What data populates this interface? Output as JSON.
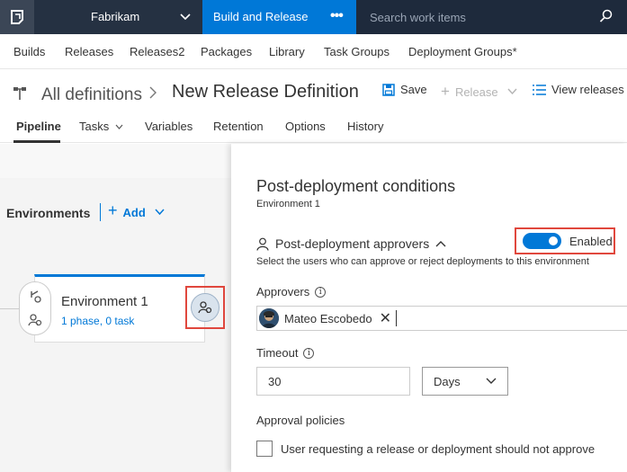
{
  "topnav": {
    "org": "Fabrikam",
    "active_hub": "Build and Release",
    "more": "•••",
    "search_placeholder": "Search work items"
  },
  "hubs": [
    "Builds",
    "Releases",
    "Releases2",
    "Packages",
    "Library",
    "Task Groups",
    "Deployment Groups*"
  ],
  "breadcrumb": {
    "all": "All definitions",
    "title": "New Release Definition"
  },
  "toolbar": {
    "save": "Save",
    "release": "Release",
    "view_releases": "View releases"
  },
  "tabs": [
    "Pipeline",
    "Tasks",
    "Variables",
    "Retention",
    "Options",
    "History"
  ],
  "pipeline": {
    "environments_label": "Environments",
    "add_label": "Add",
    "environment": {
      "name": "Environment 1",
      "summary": "1 phase, 0 task"
    }
  },
  "panel": {
    "title": "Post-deployment conditions",
    "subtitle": "Environment 1",
    "approvers_section": "Post-deployment approvers",
    "enabled_label": "Enabled",
    "enabled": true,
    "description": "Select the users who can approve or reject deployments to this environment",
    "approvers_label": "Approvers",
    "approver_name": "Mateo Escobedo",
    "timeout_label": "Timeout",
    "timeout_value": "30",
    "timeout_unit": "Days",
    "policies_label": "Approval policies",
    "policy_1": "User requesting a release or deployment should not approve"
  },
  "colors": {
    "accent": "#0078d7",
    "topbar": "#253142",
    "highlight": "#e0473d"
  }
}
